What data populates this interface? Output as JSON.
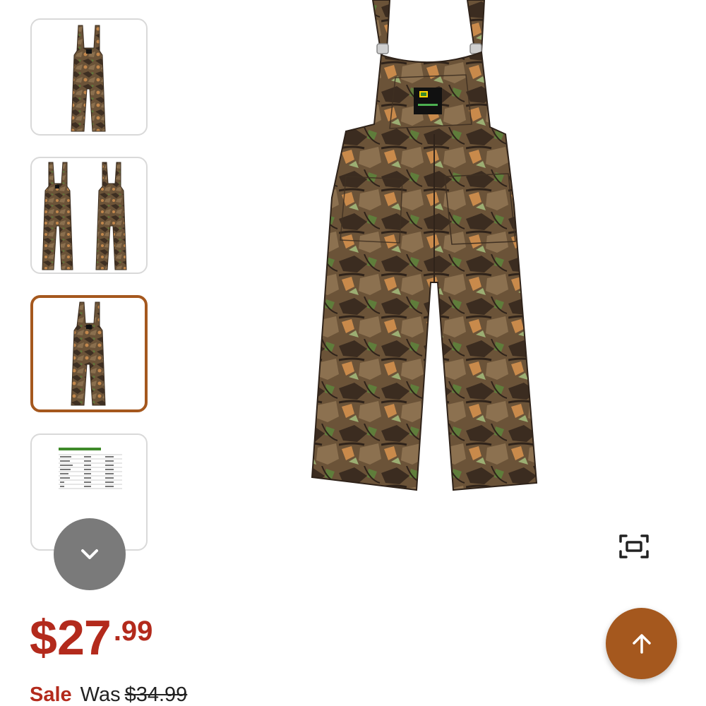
{
  "gallery": {
    "thumbnails": [
      {
        "name": "front view",
        "selected": false
      },
      {
        "name": "front and back view",
        "selected": false
      },
      {
        "name": "front view alt",
        "selected": true
      },
      {
        "name": "size chart",
        "selected": false
      }
    ],
    "size_chart_title": "Newborn - Child Apparel Sizing"
  },
  "product": {
    "price_currency": "$",
    "price_dollars": "27",
    "price_cents": ".99",
    "sale_label": "Sale",
    "was_label": "Was",
    "was_price": "$34.99"
  },
  "colors": {
    "price_red": "#b32a1c",
    "accent_brown": "#a5581e",
    "scroll_gray": "#7a7a7a"
  },
  "icons": {
    "scroll_down": "chevron-down-icon",
    "fullscreen": "fullscreen-icon",
    "back_to_top": "arrow-up-icon"
  }
}
